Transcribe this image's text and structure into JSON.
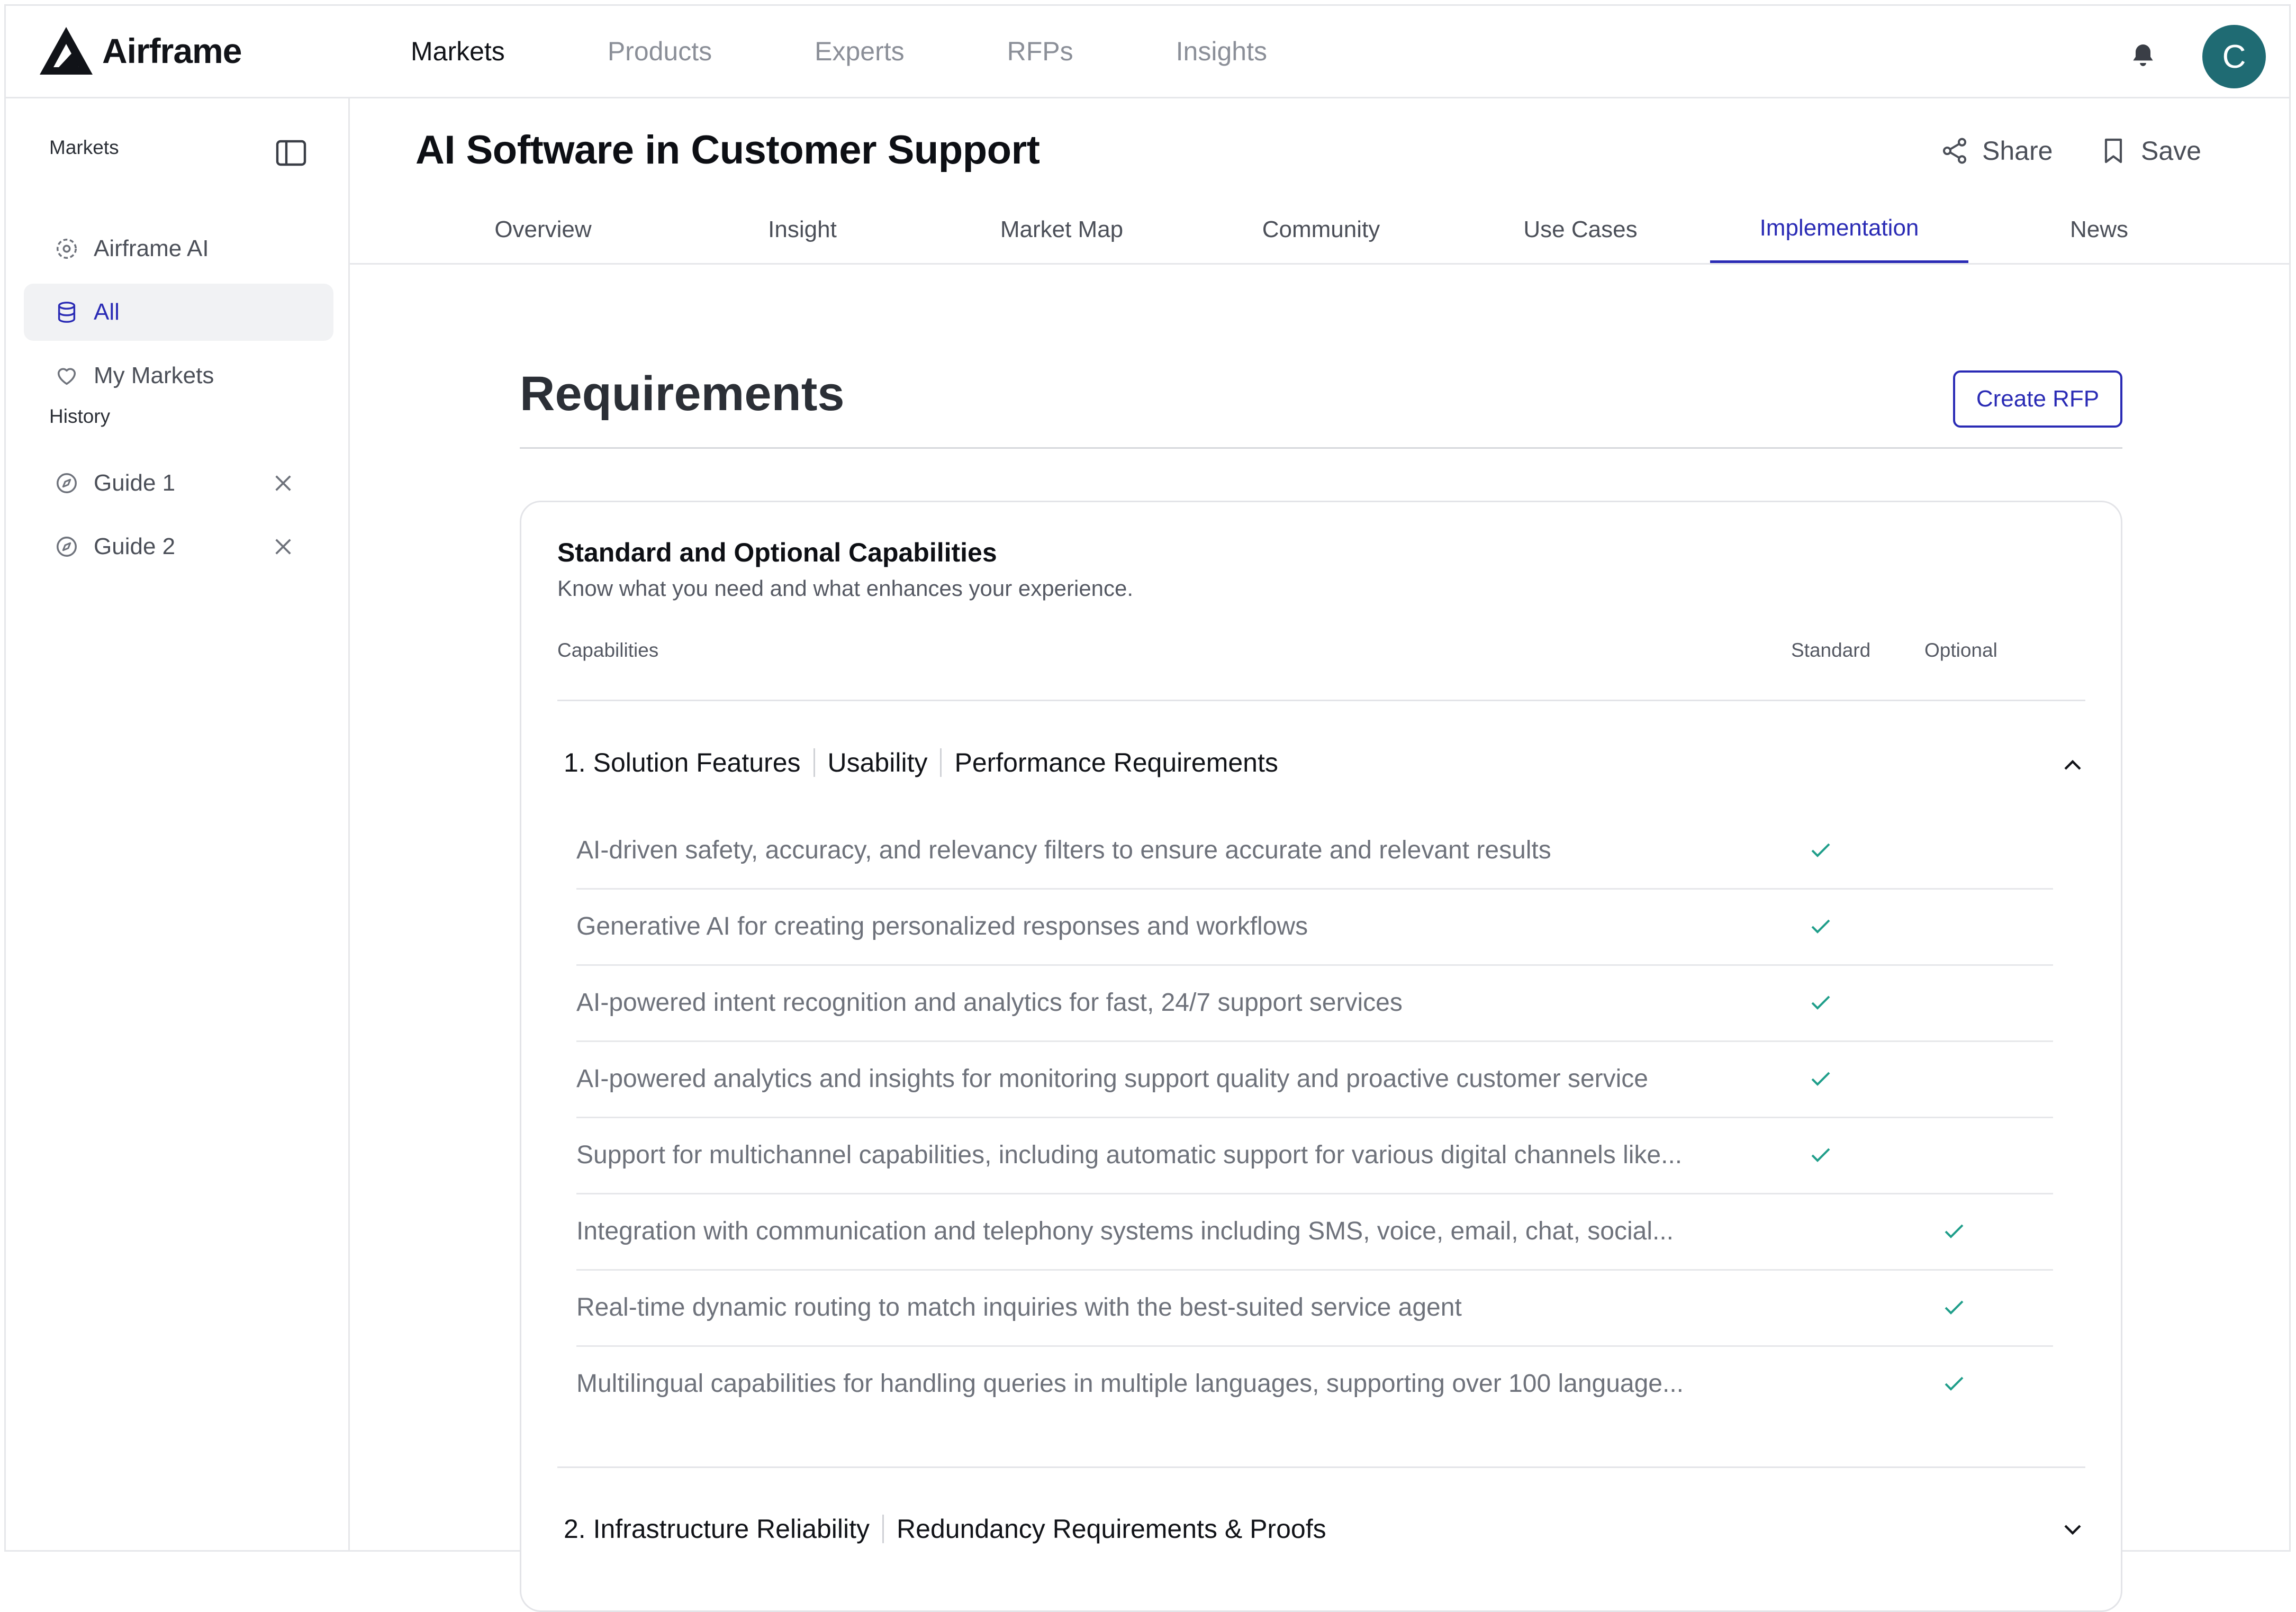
{
  "app": {
    "name": "Airframe"
  },
  "topnav": {
    "items": [
      {
        "label": "Markets",
        "active": true
      },
      {
        "label": "Products",
        "active": false
      },
      {
        "label": "Experts",
        "active": false
      },
      {
        "label": "RFPs",
        "active": false
      },
      {
        "label": "Insights",
        "active": false
      }
    ],
    "avatar_initial": "C"
  },
  "sidebar": {
    "heading": "Markets",
    "items": [
      {
        "label": "Airframe AI",
        "icon": "ai-sparkle-icon",
        "active": false
      },
      {
        "label": "All",
        "icon": "database-icon",
        "active": true
      },
      {
        "label": "My Markets",
        "icon": "heart-icon",
        "active": false
      }
    ],
    "history_heading": "History",
    "history": [
      {
        "label": "Guide 1",
        "icon": "compass-icon"
      },
      {
        "label": "Guide 2",
        "icon": "compass-icon"
      }
    ]
  },
  "page": {
    "title": "AI Software in Customer Support",
    "share_label": "Share",
    "save_label": "Save",
    "tabs": [
      {
        "label": "Overview",
        "active": false
      },
      {
        "label": "Insight",
        "active": false
      },
      {
        "label": "Market Map",
        "active": false
      },
      {
        "label": "Community",
        "active": false
      },
      {
        "label": "Use Cases",
        "active": false
      },
      {
        "label": "Implementation",
        "active": true
      },
      {
        "label": "News",
        "active": false
      }
    ]
  },
  "requirements": {
    "title": "Requirements",
    "create_rfp_label": "Create RFP",
    "card": {
      "title": "Standard and Optional Capabilities",
      "subtitle": "Know what you need and what enhances your experience.",
      "col_capabilities": "Capabilities",
      "col_standard": "Standard",
      "col_optional": "Optional",
      "sections": [
        {
          "number": "1.",
          "parts": [
            "Solution Features",
            "Usability",
            "Performance Requirements"
          ],
          "expanded": true,
          "rows": [
            {
              "text": "AI-driven safety, accuracy, and relevancy filters to ensure accurate and relevant results",
              "type": "standard"
            },
            {
              "text": "Generative AI for creating personalized responses and workflows",
              "type": "standard"
            },
            {
              "text": "AI-powered intent recognition and analytics for fast, 24/7 support services",
              "type": "standard"
            },
            {
              "text": "AI-powered analytics and insights for monitoring support quality and proactive customer service",
              "type": "standard"
            },
            {
              "text": "Support for multichannel capabilities, including automatic support for various digital channels like...",
              "type": "standard"
            },
            {
              "text": "Integration with communication and telephony systems including SMS, voice, email, chat, social...",
              "type": "optional"
            },
            {
              "text": "Real-time dynamic routing to match inquiries with the best-suited service agent",
              "type": "optional"
            },
            {
              "text": "Multilingual capabilities for handling queries in multiple languages, supporting over 100 language...",
              "type": "optional"
            }
          ]
        },
        {
          "number": "2.",
          "parts": [
            "Infrastructure Reliability",
            "Redundancy Requirements & Proofs"
          ],
          "expanded": false
        }
      ]
    }
  },
  "colors": {
    "accent": "#2a2bb5",
    "check": "#1f9e8a",
    "avatar": "#1f6b73"
  }
}
